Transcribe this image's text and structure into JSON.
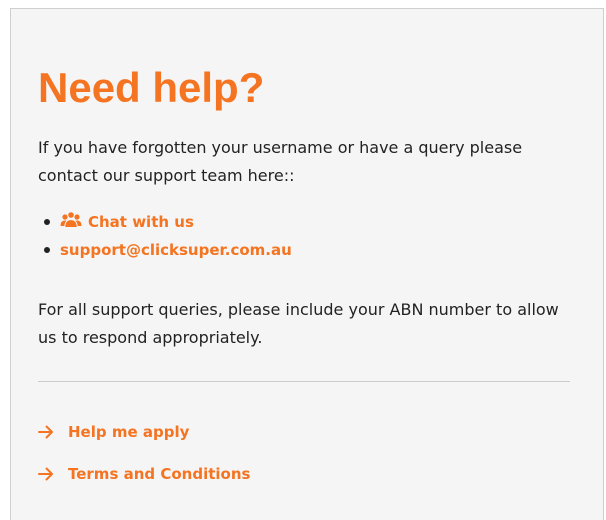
{
  "help": {
    "title": "Need help?",
    "intro": "If you have forgotten your username or have a query please contact our support team here::",
    "links": [
      {
        "label": "Chat with us",
        "icon": "people-group-icon"
      },
      {
        "label": "support@clicksuper.com.au"
      }
    ],
    "support_note": "For all support queries, please include your ABN number to allow us to respond appropriately.",
    "actions": [
      {
        "label": "Help me apply",
        "icon": "arrow-right-icon"
      },
      {
        "label": "Terms and Conditions",
        "icon": "arrow-right-icon"
      }
    ]
  },
  "colors": {
    "accent": "#f47421",
    "text": "#222222",
    "panel_background": "#f5f5f5",
    "divider": "#cccccc"
  }
}
